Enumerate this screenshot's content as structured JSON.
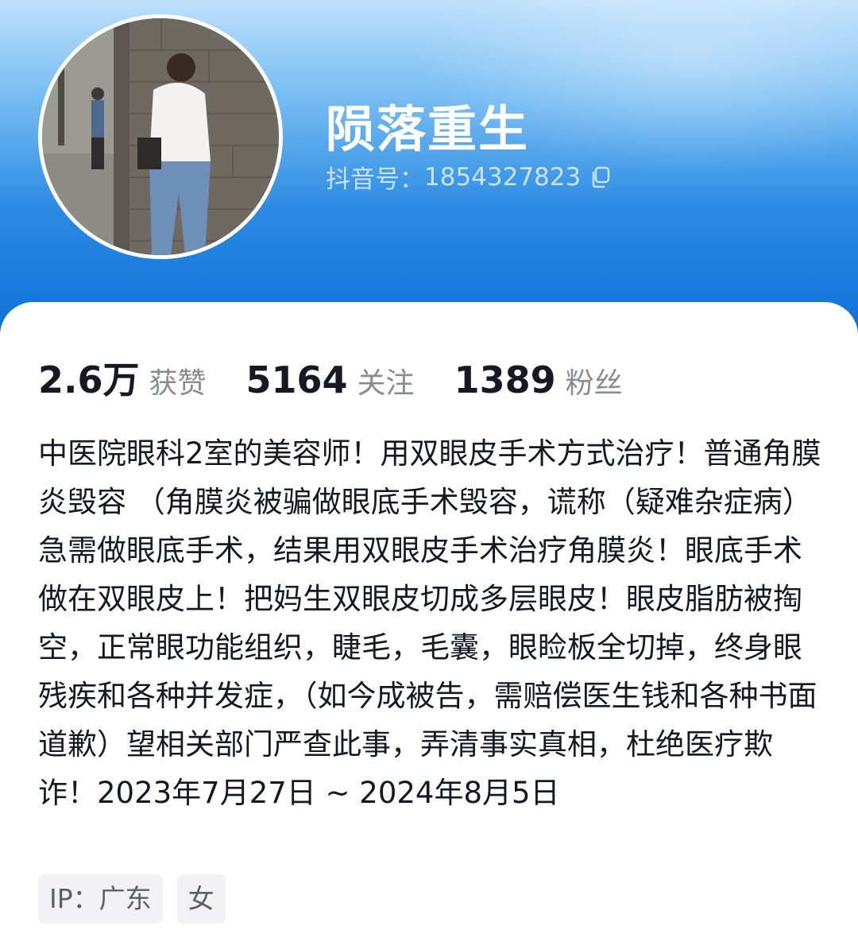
{
  "profile": {
    "username": "陨落重生",
    "douyin_id_label": "抖音号：",
    "douyin_id": "1854327823",
    "avatar_icon": "profile-photo"
  },
  "stats": [
    {
      "value": "2.6万",
      "label": "获赞"
    },
    {
      "value": "5164",
      "label": "关注"
    },
    {
      "value": "1389",
      "label": "粉丝"
    }
  ],
  "bio": "中医院眼科2室的美容师！用双眼皮手术方式治疗！普通角膜炎毁容 （角膜炎被骗做眼底手术毁容，谎称（疑难杂症病）急需做眼底手术，结果用双眼皮手术治疗角膜炎！眼底手术做在双眼皮上！把妈生双眼皮切成多层眼皮！眼皮脂肪被掏空，正常眼功能组织，睫毛，毛囊，眼睑板全切掉，终身眼残疾和各种并发症，（如今成被告，需赔偿医生钱和各种书面道歉）望相关部门严查此事，弄清事实真相，杜绝医疗欺诈！2023年7月27日 ~ 2024年8月5日",
  "tags": [
    {
      "text": "IP：广东"
    },
    {
      "text": "女"
    }
  ],
  "colors": {
    "header_top": "#bfe0fa",
    "header_bottom": "#0d6fd6",
    "text_primary": "#161823",
    "text_secondary": "#8a8b91",
    "tag_bg": "#f2f2f4"
  }
}
